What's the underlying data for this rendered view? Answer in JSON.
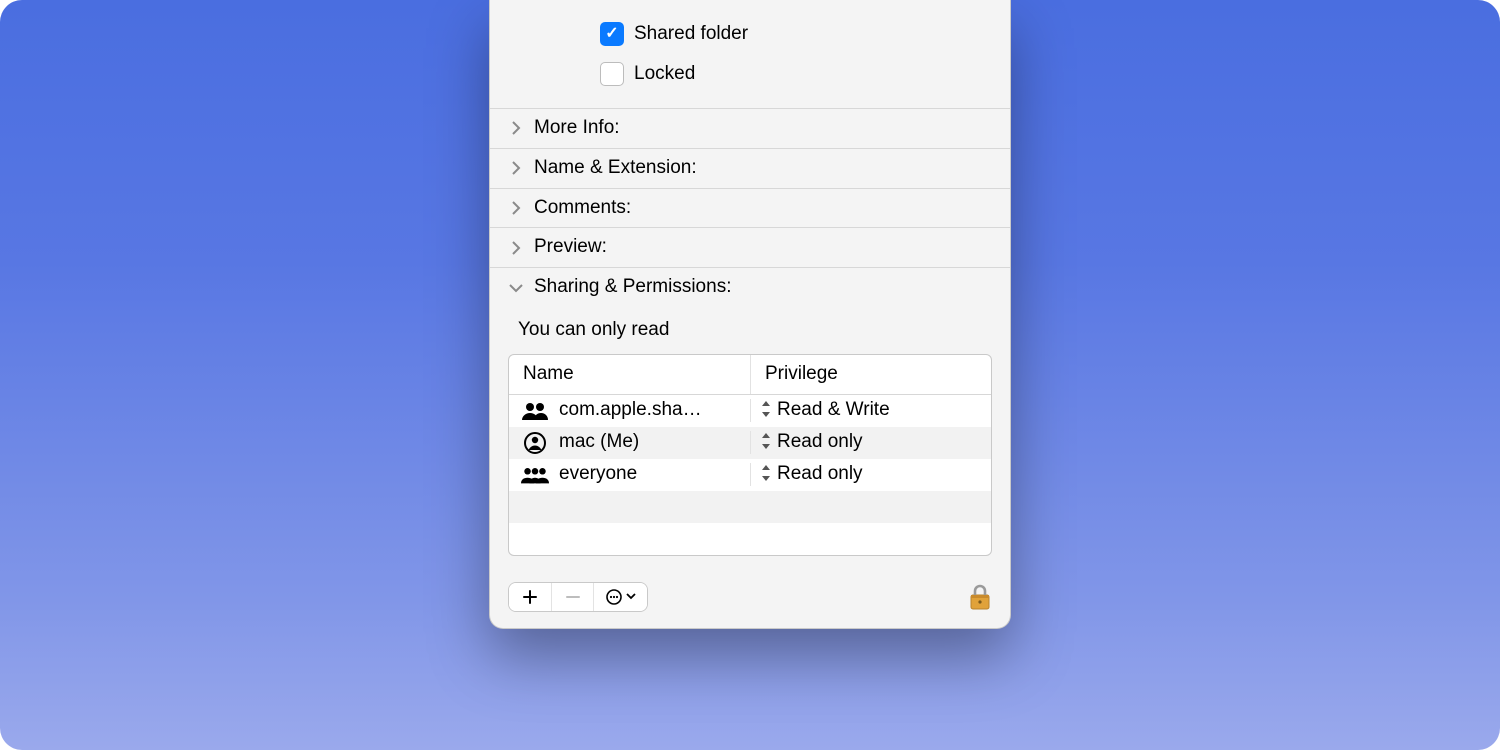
{
  "general": {
    "shared_folder": {
      "label": "Shared folder",
      "checked": true
    },
    "locked": {
      "label": "Locked",
      "checked": false
    }
  },
  "sections": {
    "more_info": "More Info:",
    "name_ext": "Name & Extension:",
    "comments": "Comments:",
    "preview": "Preview:",
    "sharing": "Sharing & Permissions:"
  },
  "sharing": {
    "hint": "You can only read",
    "columns": {
      "name": "Name",
      "privilege": "Privilege"
    },
    "rows": [
      {
        "icon": "group",
        "name": "com.apple.sha…",
        "privilege": "Read & Write"
      },
      {
        "icon": "user",
        "name": "mac (Me)",
        "privilege": "Read only"
      },
      {
        "icon": "group3",
        "name": "everyone",
        "privilege": "Read only"
      }
    ]
  },
  "footer": {
    "add": "+",
    "remove": "−",
    "action_menu": "…"
  }
}
